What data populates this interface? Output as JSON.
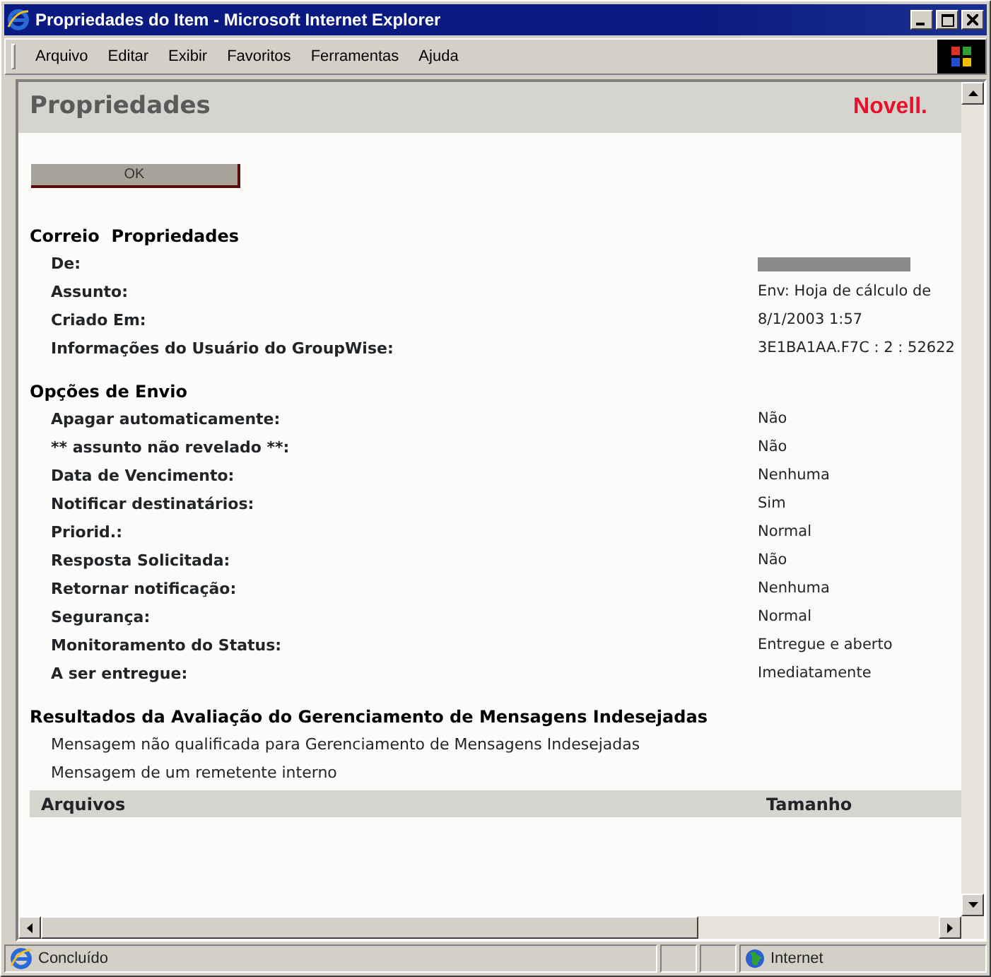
{
  "window": {
    "title": "Propriedades do Item - Microsoft Internet Explorer"
  },
  "menu": [
    "Arquivo",
    "Editar",
    "Exibir",
    "Favoritos",
    "Ferramentas",
    "Ajuda"
  ],
  "page": {
    "heading": "Propriedades",
    "logo": "Novell.",
    "ok_button": "OK"
  },
  "sections": [
    {
      "kind": "fields",
      "title": "Correio  Propriedades",
      "rows": [
        {
          "label": "De:",
          "redacted": true
        },
        {
          "label": "Assunto:",
          "value": "Env: Hoja de cálculo de"
        },
        {
          "label": "Criado Em:",
          "value": "8/1/2003 1:57"
        },
        {
          "label": "Informações do Usuário do GroupWise:",
          "value": "3E1BA1AA.F7C : 2 : 52622"
        }
      ]
    },
    {
      "kind": "fields",
      "title": "Opções de Envio",
      "rows": [
        {
          "label": "Apagar automaticamente:",
          "value": "Não"
        },
        {
          "label": "** assunto não revelado **:",
          "value": "Não"
        },
        {
          "label": "Data de Vencimento:",
          "value": "Nenhuma"
        },
        {
          "label": "Notificar destinatários:",
          "value": "Sim"
        },
        {
          "label": "Priorid.:",
          "value": "Normal"
        },
        {
          "label": "Resposta Solicitada:",
          "value": "Não"
        },
        {
          "label": "Retornar notificação:",
          "value": "Nenhuma"
        },
        {
          "label": "Segurança:",
          "value": "Normal"
        },
        {
          "label": "Monitoramento do Status:",
          "value": "Entregue e aberto"
        },
        {
          "label": "A ser entregue:",
          "value": "Imediatamente"
        }
      ]
    },
    {
      "kind": "lines",
      "title": "Resultados da Avaliação do Gerenciamento de Mensagens Indesejadas",
      "lines": [
        "Mensagem não qualificada para Gerenciamento de Mensagens Indesejadas",
        "Mensagem de um remetente interno"
      ]
    }
  ],
  "files_table": {
    "columns": [
      "Arquivos",
      "Tamanho"
    ]
  },
  "status_bar": {
    "text": "Concluído",
    "zone": "Internet"
  }
}
